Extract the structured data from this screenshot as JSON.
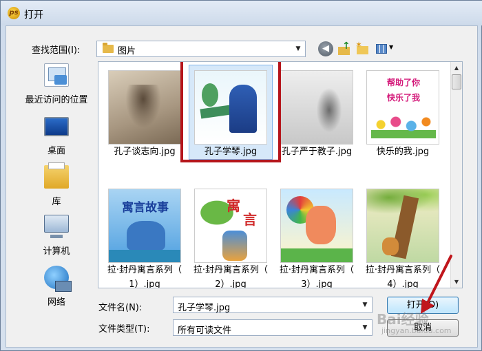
{
  "window": {
    "title": "打开"
  },
  "lookin": {
    "label": "查找范围(I):",
    "value": "图片"
  },
  "places": [
    {
      "label": "最近访问的位置"
    },
    {
      "label": "桌面"
    },
    {
      "label": "库"
    },
    {
      "label": "计算机"
    },
    {
      "label": "网络"
    }
  ],
  "files": [
    {
      "name": "孔子谈志向.jpg"
    },
    {
      "name": "孔子学琴.jpg"
    },
    {
      "name": "孔子严于教子.jpg"
    },
    {
      "name": "快乐的我.jpg"
    },
    {
      "name": "拉·封丹寓言系列（",
      "name2": "1）.jpg"
    },
    {
      "name": "拉·封丹寓言系列（",
      "name2": "2）.jpg"
    },
    {
      "name": "拉·封丹寓言系列（",
      "name2": "3）.jpg"
    },
    {
      "name": "拉·封丹寓言系列（",
      "name2": "4）.jpg"
    }
  ],
  "thumb_text": {
    "kid_line1": "帮助了你",
    "kid_line2": "快乐了我",
    "fable": "寓言故事",
    "yu1": "寓",
    "yu2": "言"
  },
  "filename": {
    "label": "文件名(N):",
    "value": "孔子学琴.jpg"
  },
  "filetype": {
    "label": "文件类型(T):",
    "value": "所有可读文件"
  },
  "buttons": {
    "open": "打开(O)",
    "cancel": "取消"
  },
  "watermark": {
    "brand": "Bai经验",
    "url": "jingyan.baidu.com"
  },
  "colors": {
    "highlight": "#b5151b",
    "selection": "#d6e8f9"
  }
}
